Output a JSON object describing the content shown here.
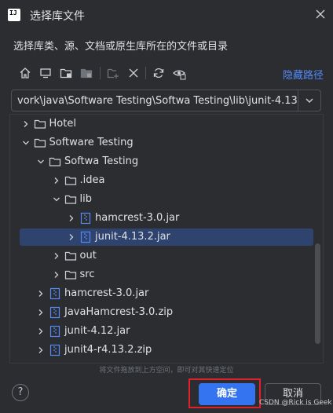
{
  "window": {
    "app_icon_text": "IJ",
    "title": "选择库文件"
  },
  "description": "选择库类、源、文档或原生库所在的文件或目录",
  "toolbar": {
    "buttons": [
      "home-icon",
      "desktop-icon",
      "project-folder-icon",
      "module-folder-icon",
      "new-folder-icon",
      "delete-icon",
      "refresh-icon",
      "show-hidden-icon"
    ],
    "hide_path_label": "隐藏路径"
  },
  "path": {
    "value": "vork\\java\\Software Testing\\Softwa Testing\\lib\\junit-4.13.2.jar"
  },
  "tree": {
    "rows": [
      {
        "label": "Hotel",
        "expanded": false,
        "type": "folder"
      },
      {
        "label": "Software Testing",
        "expanded": true,
        "type": "folder"
      },
      {
        "label": "Softwa Testing",
        "expanded": true,
        "type": "folder"
      },
      {
        "label": ".idea",
        "expanded": false,
        "type": "folder"
      },
      {
        "label": "lib",
        "expanded": true,
        "type": "folder"
      },
      {
        "label": "hamcrest-3.0.jar",
        "expanded": false,
        "type": "archive"
      },
      {
        "label": "junit-4.13.2.jar",
        "expanded": false,
        "type": "archive",
        "selected": true
      },
      {
        "label": "out",
        "expanded": false,
        "type": "folder"
      },
      {
        "label": "src",
        "expanded": false,
        "type": "folder"
      },
      {
        "label": "hamcrest-3.0.jar",
        "expanded": false,
        "type": "archive"
      },
      {
        "label": "JavaHamcrest-3.0.zip",
        "expanded": false,
        "type": "archive"
      },
      {
        "label": "junit-4.12.jar",
        "expanded": false,
        "type": "archive"
      },
      {
        "label": "junit4-r4.13.2.zip",
        "expanded": false,
        "type": "archive"
      }
    ]
  },
  "hint": "将文件拖放到上方空间，即可对其快速定位",
  "footer": {
    "help_label": "?",
    "ok_label": "确定",
    "cancel_label": "取消"
  },
  "watermark": "CSDN @Rick is Geek",
  "colors": {
    "accent": "#3574f0",
    "selection": "#2e436e",
    "link": "#548af7",
    "highlight_box": "#e0202a"
  }
}
